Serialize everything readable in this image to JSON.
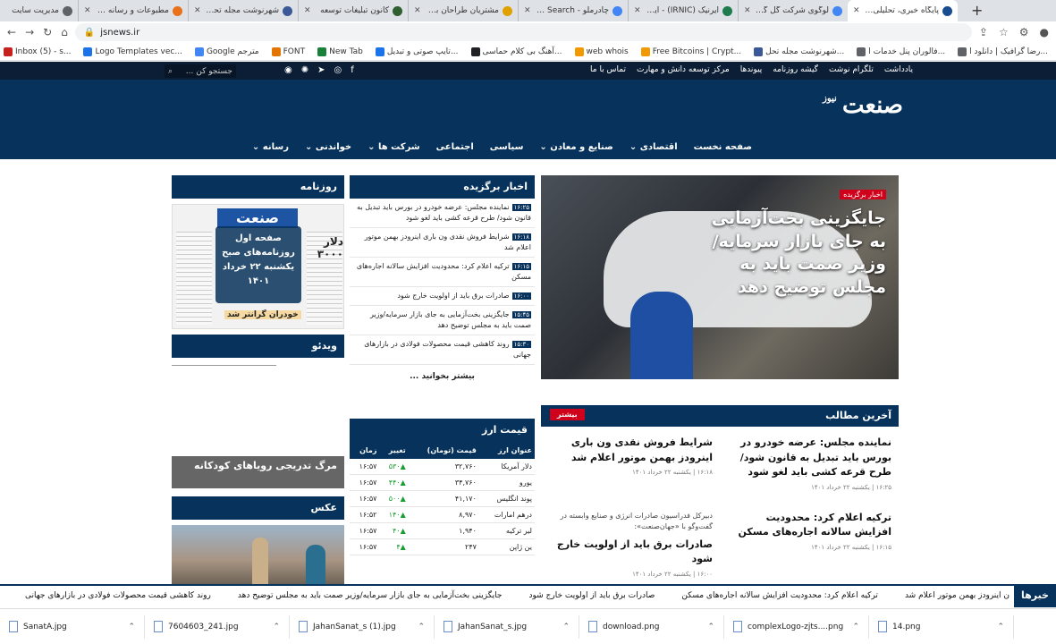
{
  "browser": {
    "tabs": [
      {
        "title": "پایگاه خبری، تحلیلی و اط",
        "color": "#1a4d8f",
        "active": true
      },
      {
        "title": "لوگوی شرکت گل گهر -",
        "color": "#4285f4"
      },
      {
        "title": "ایرنیک (IRNIC) - ایرنیک",
        "color": "#1e7b4e"
      },
      {
        "title": "چادرملو - Google Search",
        "color": "#4285f4"
      },
      {
        "title": "مشتریان طراحان برتر |",
        "color": "#e0a000"
      },
      {
        "title": "کانون تبلیغات توسعه",
        "color": "#2f5f2f"
      },
      {
        "title": "شهرنوشت مجله تحلیلی",
        "color": "#3b5998"
      },
      {
        "title": "مطبوعات و رسانه جهان",
        "color": "#e8711a"
      },
      {
        "title": "مدیریت سایت",
        "color": "#5f6368"
      }
    ],
    "url": "jsnews.ir",
    "bookmarks": [
      "Inbox (5) - s...",
      "Logo Templates vec...",
      "Google مترجم",
      "FONT",
      "New Tab",
      "تایپ صوتی و تبدیل...",
      "آهنگ بی کلام حماسی...",
      "web whois",
      "Free Bitcoins | Crypt...",
      "شهرنوشت مجله تحل...",
      "فالوران پنل خدمات ا...",
      "رضا گرافیک | دانلود ا..."
    ]
  },
  "site": {
    "top_links": [
      "یادداشت",
      "تلگرام نوشت",
      "گیشه روزنامه",
      "پیوندها",
      "مرکز توسعه دانش و مهارت",
      "تماس با ما"
    ],
    "search_placeholder": "جستجو کن ...",
    "logo_text": "صنعت",
    "logo_sub": "نیوز",
    "nav": [
      "صفحه نخست",
      "اقتصادی",
      "صنایع و معادن",
      "سیاسی",
      "اجتماعی",
      "شرکت ها",
      "خواندنی",
      "رسانه"
    ]
  },
  "hero": {
    "badge": "اخبار برگزیده",
    "title": "جایگزینی بخت‌آزمایی به جای بازار سرمایه/وزیر صمت باید به مجلس توضیح دهد"
  },
  "featured": {
    "heading": "اخبار برگزیده",
    "items": [
      {
        "time": "۱۶:۲۵",
        "text": "نماینده مجلس: عرضه خودرو در بورس باید تبدیل به قانون شود/ طرح قرعه کشی باید لغو شود"
      },
      {
        "time": "۱۶:۱۸",
        "text": "شرایط فروش نقدی ون باری اینرودز بهمن موتور اعلام شد"
      },
      {
        "time": "۱۶:۱۵",
        "text": "ترکیه اعلام کرد: محدودیت افزایش سالانه اجاره‌های مسکن"
      },
      {
        "time": "۱۶:۰۰",
        "text": "صادرات برق باید از اولویت خارج شود"
      },
      {
        "time": "۱۵:۴۵",
        "text": "جایگزینی بخت‌آزمایی به جای بازار سرمایه/وزیر صمت باید به مجلس توضیح دهد"
      },
      {
        "time": "۱۵:۳۰",
        "text": "روند کاهشی قیمت محصولات فولادی در بازارهای جهانی"
      }
    ],
    "more": "بیشتر بخوانید ..."
  },
  "newspaper": {
    "heading": "روزنامه",
    "masthead": "صنعت",
    "overlay": "صفحه اول روزنامه‌های صبح یکشنبه ۲۲ خرداد ۱۴۰۱",
    "big": "دلار ۳۰۰۰",
    "foot": "خودران گرانتر شد"
  },
  "video": {
    "heading": "ویدئو"
  },
  "gray_band": "مرگ تدریجی رویاهای کودکانه",
  "photo": {
    "heading": "عکس"
  },
  "fx": {
    "heading": "قیمت ارز",
    "columns": [
      "عنوان ارز",
      "قیمت (تومان)",
      "تغییر",
      "زمان"
    ],
    "rows": [
      {
        "name": "دلار آمریکا",
        "price": "۳۲,۷۶۰",
        "change": "▲۵۳۰",
        "time": "۱۶:۵۷"
      },
      {
        "name": "یورو",
        "price": "۳۴,۷۶۰",
        "change": "▲۴۴۰",
        "time": "۱۶:۵۷"
      },
      {
        "name": "پوند انگلیس",
        "price": "۴۱,۱۷۰",
        "change": "▲۵۰۰",
        "time": "۱۶:۵۷"
      },
      {
        "name": "درهم امارات",
        "price": "۸,۹۷۰",
        "change": "▲۱۴۰",
        "time": "۱۶:۵۲"
      },
      {
        "name": "لیر ترکیه",
        "price": "۱,۹۴۰",
        "change": "▲۴۰",
        "time": "۱۶:۵۷"
      },
      {
        "name": "ین ژاپن",
        "price": "۲۴۷",
        "change": "▲۴",
        "time": "۱۶:۵۷"
      }
    ]
  },
  "latest": {
    "heading": "آخرین مطالب",
    "more_btn": "بیشتر",
    "items": [
      {
        "title": "نماینده مجلس: عرضه خودرو در بورس باید تبدیل به قانون شود/ طرح قرعه کشی باید لغو شود",
        "date": "۱۶:۲۵ | یکشنبه ۲۲ خرداد ۱۴۰۱"
      },
      {
        "title": "شرایط فروش نقدی ون باری اینرودز بهمن موتور اعلام شد",
        "date": "۱۶:۱۸ | یکشنبه ۲۲ خرداد ۱۴۰۱"
      },
      {
        "title": "ترکیه اعلام کرد: محدودیت افزایش سالانه اجاره‌های مسکن",
        "date": "۱۶:۱۵ | یکشنبه ۲۲ خرداد ۱۴۰۱"
      },
      {
        "lead": "دبیرکل فدراسیون صادرات انرژی و صنایع وابسته در گفت‌وگو با «جهان‌صنعت»:",
        "title": "صادرات برق باید از اولویت خارج شود",
        "date": "۱۶:۰۰ | یکشنبه ۲۲ خرداد ۱۴۰۱"
      }
    ]
  },
  "ticker": {
    "label": "خبرها",
    "items": [
      "ن اینرودز بهمن موتور اعلام شد",
      "ترکیه اعلام کرد: محدودیت افزایش سالانه اجاره‌های مسکن",
      "صادرات برق باید از اولویت خارج شود",
      "جایگزینی بخت‌آزمایی به جای بازار سرمایه/وزیر صمت باید به مجلس توضیح دهد",
      "روند کاهشی قیمت محصولات فولادی در بازارهای جهانی",
      "نحوه"
    ]
  },
  "downloads": [
    "SanatA.jpg",
    "7604603_241.jpg",
    "JahanSanat_s (1).jpg",
    "JahanSanat_s.jpg",
    "download.png",
    "complexLogo-zjts....png",
    "14.png"
  ]
}
